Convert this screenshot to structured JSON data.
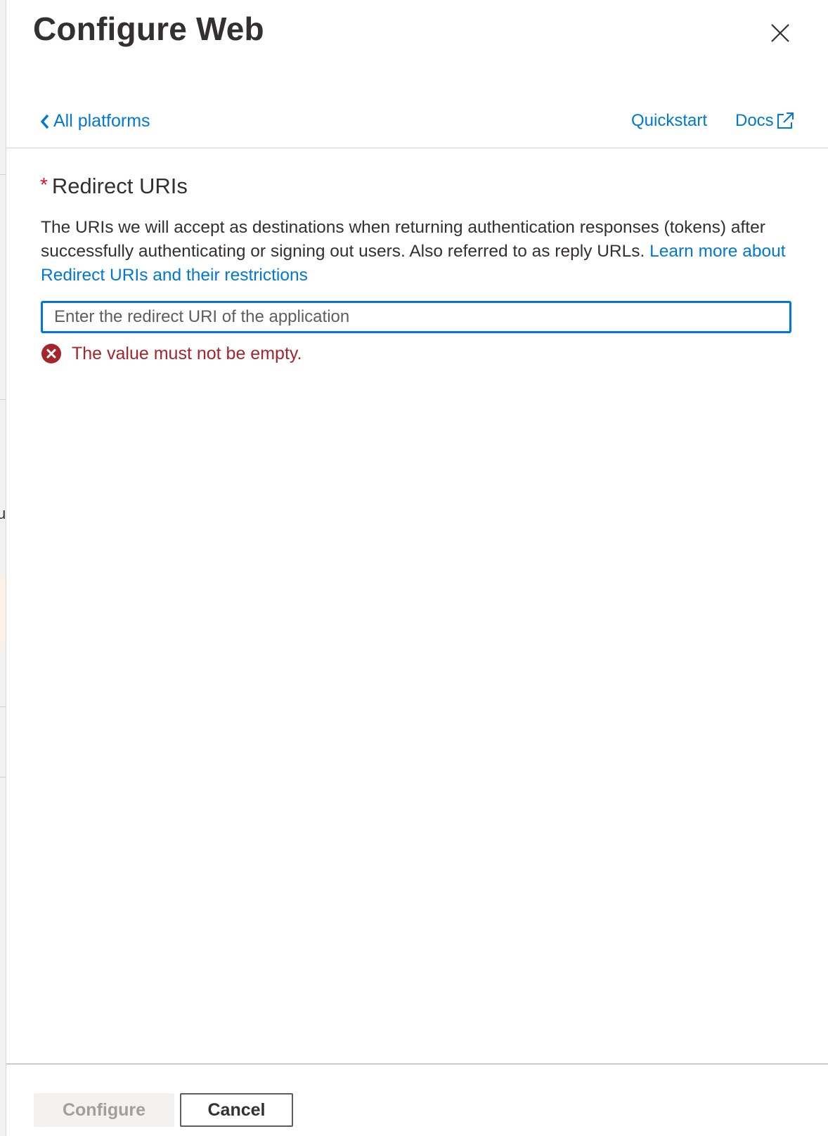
{
  "panel": {
    "title": "Configure Web",
    "close_icon": "close-icon"
  },
  "nav": {
    "back_label": "All platforms",
    "back_icon": "chevron-left-icon",
    "quickstart_label": "Quickstart",
    "docs_label": "Docs",
    "docs_icon": "external-link-icon"
  },
  "redirect": {
    "required_marker": "*",
    "label": "Redirect URIs",
    "description": "The URIs we will accept as destinations when returning authentication responses (tokens) after successfully authenticating or signing out users. Also referred to as reply URLs.",
    "learn_more_label": "Learn more about Redirect URIs and their restrictions",
    "input_value": "",
    "input_placeholder": "Enter the redirect URI of the application",
    "error_icon": "error-icon",
    "error_message": "The value must not be empty."
  },
  "footer": {
    "configure_label": "Configure",
    "configure_disabled": true,
    "cancel_label": "Cancel"
  },
  "backdrop": {
    "partial_text": "u"
  },
  "colors": {
    "accent": "#0078d4",
    "error": "#a4262c",
    "required": "#e81123",
    "text": "#323130"
  }
}
